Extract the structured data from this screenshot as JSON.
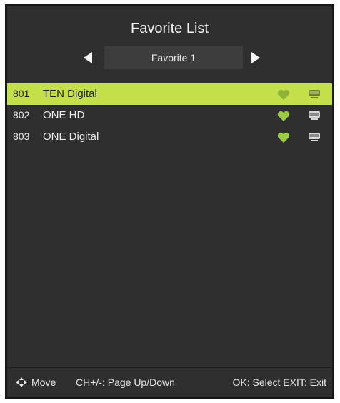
{
  "header": {
    "title": "Favorite List",
    "group_label": "Favorite 1"
  },
  "channels": [
    {
      "number": "801",
      "name": "TEN Digital",
      "selected": true
    },
    {
      "number": "802",
      "name": "ONE HD",
      "selected": false
    },
    {
      "number": "803",
      "name": "ONE Digital",
      "selected": false
    }
  ],
  "footer": {
    "move": "Move",
    "page": "CH+/-: Page Up/Down",
    "ok_exit": "OK: Select EXIT: Exit"
  },
  "colors": {
    "panel": "#2f2f2f",
    "highlight": "#c3df49",
    "heart": "#9ccf3f",
    "heart_dim": "#8fb33a"
  },
  "icons": [
    "left-arrow-icon",
    "right-arrow-icon",
    "heart-icon",
    "tv-icon",
    "move-icon"
  ]
}
